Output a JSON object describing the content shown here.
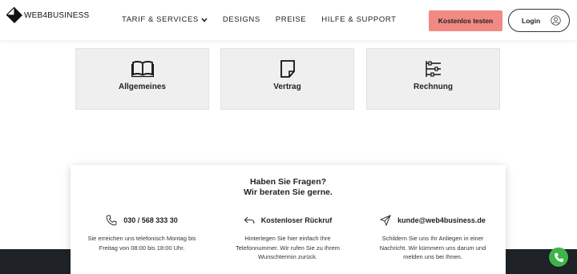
{
  "header": {
    "logo_text": "WEB4BUSINESS",
    "nav": [
      {
        "label": "TARIF & SERVICES",
        "has_dropdown": true
      },
      {
        "label": "DESIGNS"
      },
      {
        "label": "PREISE"
      },
      {
        "label": "HILFE & SUPPORT"
      }
    ],
    "cta_label": "Kostenlos testen",
    "login_label": "Login"
  },
  "categories": [
    {
      "label": "Allgemeines",
      "icon": "open-book-icon"
    },
    {
      "label": "Vertrag",
      "icon": "document-icon"
    },
    {
      "label": "Rechnung",
      "icon": "sliders-icon"
    }
  ],
  "contact": {
    "title_line1": "Haben Sie Fragen?",
    "title_line2": "Wir beraten Sie gerne.",
    "columns": [
      {
        "icon": "phone-icon",
        "heading": "030 / 568 333 30",
        "lines": [
          "Sie erreichen uns telefonisch Montag bis",
          "Freitag von 08:00 bis 18:00 Uhr."
        ]
      },
      {
        "icon": "callback-icon",
        "heading": "Kostenloser Rückruf",
        "lines": [
          "Hinterlegen Sie hier einfach Ihre",
          "Telefonnummer. Wir rufen Sie zu Ihrem",
          "Wunschtermin zurück."
        ]
      },
      {
        "icon": "paper-plane-icon",
        "heading": "kunde@web4business.de",
        "lines": [
          "Schildern Sie uns Ihr Anliegen in einer",
          "Nachricht. Wir kümmern uns darum und",
          "melden uns bei Ihnen."
        ]
      }
    ]
  },
  "colors": {
    "cta": "#f08a82",
    "footer": "#1f2327",
    "fab": "#3cb54a"
  },
  "fab_icon": "phone-icon"
}
